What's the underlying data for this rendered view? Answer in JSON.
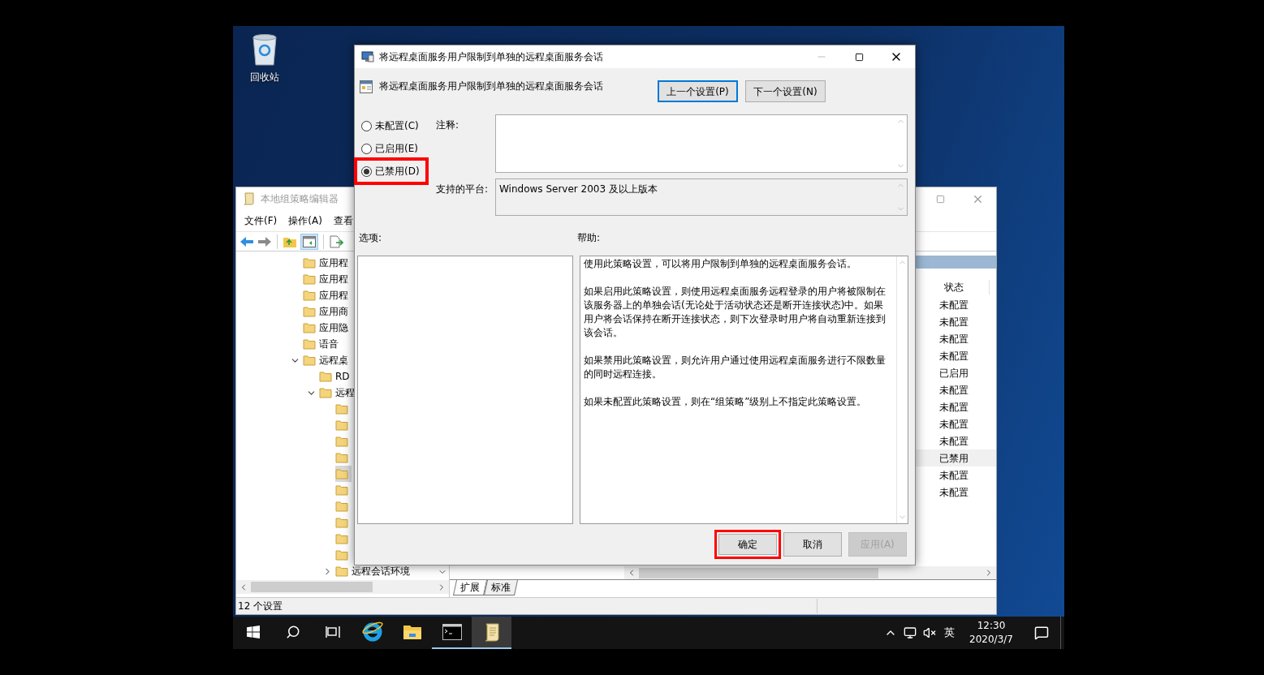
{
  "desktop": {
    "icons": [
      {
        "kind": "recycle-bin",
        "label": "回收站"
      }
    ]
  },
  "editor_window": {
    "title": "本地组策略编辑器",
    "menu": [
      "文件(F)",
      "操作(A)",
      "查看"
    ],
    "tree": [
      {
        "label": "应用程",
        "selected": false
      },
      {
        "label": "应用程",
        "selected": false
      },
      {
        "label": "应用程",
        "selected": false
      },
      {
        "label": "应用商",
        "selected": false
      },
      {
        "label": "应用隐",
        "selected": false
      },
      {
        "label": "语音",
        "selected": false
      },
      {
        "label": "远程桌",
        "selected": false,
        "expanded": true,
        "children": [
          {
            "label": "RD",
            "selected": false
          },
          {
            "label": "远程",
            "selected": false,
            "expanded": true,
            "children": [
              {
                "selected": false
              },
              {
                "selected": false
              },
              {
                "selected": false
              },
              {
                "selected": false
              },
              {
                "selected": true
              },
              {
                "selected": false
              },
              {
                "selected": false
              },
              {
                "selected": false
              },
              {
                "selected": false
              },
              {
                "selected": false
              },
              {
                "label": "远程会话环境",
                "selected": false,
                "expanded": false
              }
            ]
          }
        ]
      }
    ],
    "list": {
      "columns": [
        "状态"
      ],
      "rows": [
        {
          "status": "未配置",
          "selected": false
        },
        {
          "status": "未配置",
          "selected": false
        },
        {
          "status": "未配置",
          "selected": false
        },
        {
          "status": "未配置",
          "selected": false
        },
        {
          "status": "已启用",
          "selected": false
        },
        {
          "status": "未配置",
          "selected": false
        },
        {
          "status": "未配置",
          "selected": false
        },
        {
          "status": "未配置",
          "selected": false
        },
        {
          "status": "未配置",
          "selected": false
        },
        {
          "status": "已禁用",
          "selected": true
        },
        {
          "status": "未配置",
          "selected": false
        },
        {
          "status": "未配置",
          "selected": false
        }
      ]
    },
    "tabs": [
      {
        "label": "扩展",
        "selected": true
      },
      {
        "label": "标准",
        "selected": false
      }
    ],
    "status_bar": "12 个设置"
  },
  "dialog": {
    "title": "将远程桌面服务用户限制到单独的远程桌面服务会话",
    "heading": "将远程桌面服务用户限制到单独的远程桌面服务会话",
    "nav_buttons": [
      {
        "label": "上一个设置(P)",
        "focused": true
      },
      {
        "label": "下一个设置(N)",
        "focused": false
      }
    ],
    "options": [
      {
        "label": "未配置(C)",
        "selected": false,
        "highlighted": false
      },
      {
        "label": "已启用(E)",
        "selected": false,
        "highlighted": false
      },
      {
        "label": "已禁用(D)",
        "selected": true,
        "highlighted": true
      }
    ],
    "comment_label": "注释:",
    "platform_label": "支持的平台:",
    "platform": "Windows Server 2003 及以上版本",
    "options_label": "选项:",
    "help_label": "帮助:",
    "help": [
      "使用此策略设置，可以将用户限制到单独的远程桌面服务会话。",
      "如果启用此策略设置，则使用远程桌面服务远程登录的用户将被限制在该服务器上的单独会话(无论处于活动状态还是断开连接状态)中。如果用户将会话保持在断开连接状态，则下次登录时用户将自动重新连接到该会话。",
      "如果禁用此策略设置，则允许用户通过使用远程桌面服务进行不限数量的同时远程连接。",
      "如果未配置此策略设置，则在“组策略”级别上不指定此策略设置。"
    ],
    "buttons": [
      {
        "label": "确定",
        "highlighted": true,
        "disabled": false
      },
      {
        "label": "取消",
        "highlighted": false,
        "disabled": false
      },
      {
        "label": "应用(A)",
        "highlighted": false,
        "disabled": true
      }
    ]
  },
  "taskbar": {
    "apps": [
      {
        "kind": "start",
        "running": false,
        "active": false
      },
      {
        "kind": "search",
        "running": false,
        "active": false
      },
      {
        "kind": "task-view",
        "running": false,
        "active": false
      },
      {
        "kind": "browser",
        "running": false,
        "active": false
      },
      {
        "kind": "files",
        "running": false,
        "active": false
      },
      {
        "kind": "console",
        "running": true,
        "active": false
      },
      {
        "kind": "editor",
        "running": true,
        "active": true
      }
    ],
    "ime": "英",
    "time": "12:30",
    "date": "2020/3/7"
  }
}
